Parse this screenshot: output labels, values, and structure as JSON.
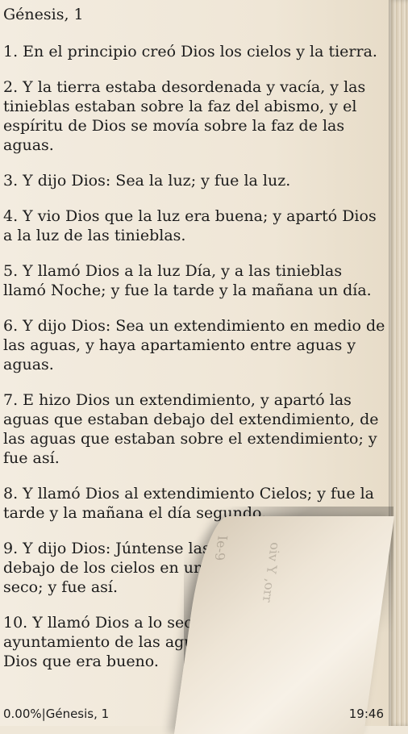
{
  "reader": {
    "chapter_title": "Génesis, 1",
    "verses": [
      "1. En el principio creó Dios los cielos y la tierra.",
      "2. Y la tierra estaba desordenada y vacía, y las tinieblas estaban  sobre la faz del abismo, y el espíritu de Dios se movía sobre la faz de las aguas.",
      "3. Y dijo Dios: Sea la luz; y fue la luz.",
      "4. Y vio Dios que la luz era  buena; y apartó Dios a la luz de las tinieblas.",
      "5. Y llamó Dios a la luz Día, y a las tinieblas llamó Noche; y fue la tarde y la mañana un día.",
      "6. Y dijo Dios: Sea un  extendimiento en medio de las aguas, y haya apartamiento entre aguas y aguas.",
      "7. E hizo Dios un extendimiento, y apartó las aguas que estaban  debajo del extendimiento, de las aguas que estaban  sobre el extendimiento; y fue así.",
      "8. Y llamó Dios al extendimiento Cielos; y fue la tarde y la mañana el día segundo.",
      "9. Y dijo Dios: Júntense las aguas que están debajo de los cielos en un lugar, y descúbrase lo seco; y fue así.",
      "10. Y llamó Dios a lo seco Tierra, y al ayuntamiento de las aguas llamó Mares; y vio Dios que era  bueno."
    ],
    "ghost_text": [
      "Ie-9",
      "oiv Y ,orr"
    ]
  },
  "status_bar": {
    "progress": "0.00%",
    "location": "Génesis, 1",
    "clock": "19:46"
  },
  "colors": {
    "paper": "#efe7d8",
    "text": "#1c1c1c"
  }
}
